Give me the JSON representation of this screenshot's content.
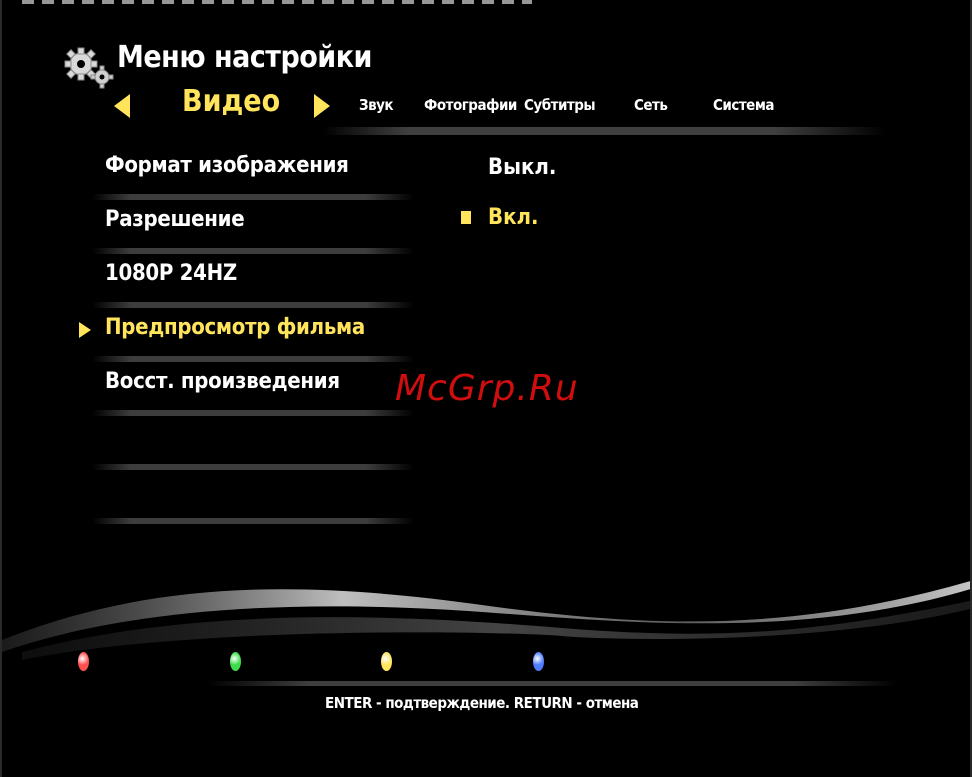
{
  "header": {
    "title": "Меню настройки",
    "icon": "gears-icon"
  },
  "tabs": {
    "active": "Видео",
    "items": [
      "Звук",
      "Фотографии",
      "Субтитры",
      "Сеть",
      "Система"
    ]
  },
  "menu": {
    "items": [
      "Формат изображения",
      "Разрешение",
      "1080P 24HZ",
      "Предпросмотр фильма",
      "Восст. произведения"
    ],
    "selected_index": 3
  },
  "options": {
    "items": [
      "Выкл.",
      "Вкл."
    ],
    "checked_index": 1
  },
  "watermark": "McGrp.Ru",
  "color_buttons": {
    "colors": [
      "#ff4f4f",
      "#3ddc4a",
      "#ffe45c",
      "#4e7bff"
    ]
  },
  "footer": {
    "hint": "ENTER - подтверждение. RETURN - отмена"
  },
  "colors": {
    "accent": "#ffe45c",
    "text": "#ffffff",
    "background": "#000000"
  }
}
